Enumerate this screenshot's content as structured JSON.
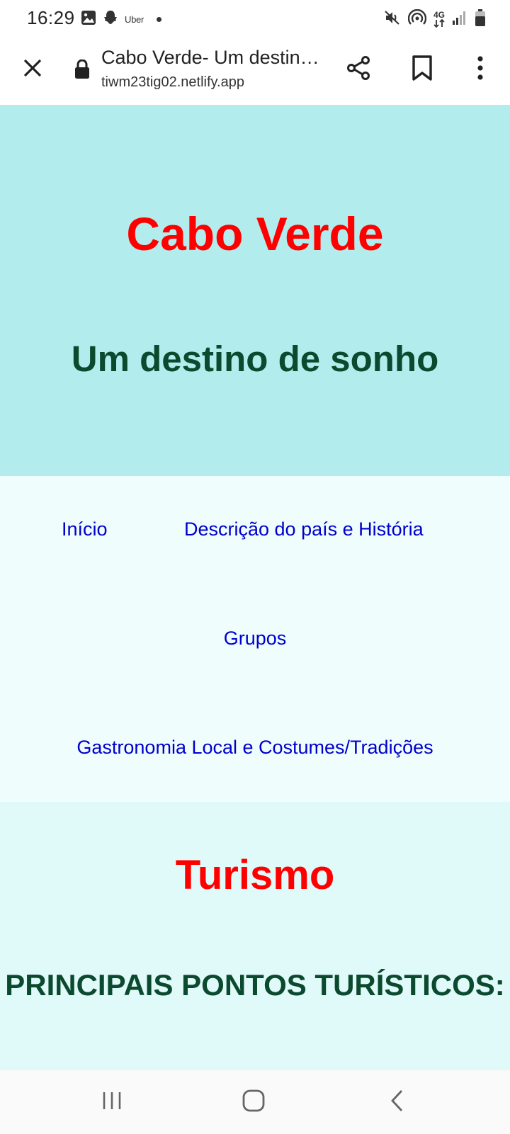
{
  "status_bar": {
    "time": "16:29",
    "uber_label": "Uber",
    "network_label": "4G",
    "icons": [
      "gallery-icon",
      "snapchat-icon",
      "uber-icon",
      "notification-dot",
      "mute-icon",
      "hotspot-icon",
      "network-4g-icon",
      "signal-icon",
      "battery-icon"
    ]
  },
  "toolbar": {
    "title": "Cabo Verde- Um destino de sonho",
    "url": "tiwm23tig02.netlify.app",
    "icons": [
      "close-icon",
      "lock-icon",
      "share-icon",
      "bookmark-icon",
      "more-vert-icon"
    ]
  },
  "hero": {
    "title": "Cabo Verde",
    "subtitle": "Um destino de sonho"
  },
  "nav": {
    "inicio": "Início",
    "descricao": "Descrição do país e História",
    "grupos": "Grupos",
    "gastronomia": "Gastronomia Local e Costumes/Tradições"
  },
  "turismo": {
    "title": "Turismo",
    "subtitle": "PRINCIPAIS PONTOS TURÍSTICOS:"
  },
  "system_nav": {
    "icons": [
      "recent-apps-icon",
      "home-icon",
      "back-icon"
    ]
  },
  "colors": {
    "hero_bg": "#b2eced",
    "nav_bg": "#effdfd",
    "turismo_bg": "#e0f9f9",
    "title_red": "#ff0000",
    "heading_green": "#0b4a2e",
    "link_blue": "#0000cc"
  }
}
